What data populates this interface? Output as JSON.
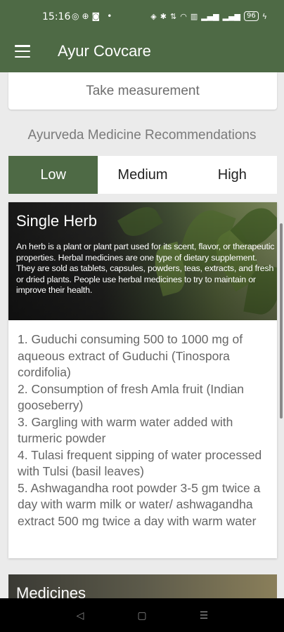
{
  "status_bar": {
    "time": "15:16",
    "left_icons": [
      "whatsapp-icon",
      "hash-icon",
      "instagram-icon",
      "dot-icon"
    ],
    "battery": "96"
  },
  "app_bar": {
    "title": "Ayur Covcare",
    "color": "#4e6a45"
  },
  "measure_button": "Take measurement",
  "section_heading": "Ayurveda Medicine Recommendations",
  "tabs": [
    {
      "label": "Low",
      "active": true
    },
    {
      "label": "Medium",
      "active": false
    },
    {
      "label": "High",
      "active": false
    }
  ],
  "herb_card": {
    "title": "Single Herb",
    "description": "An herb is a plant or plant part used for its scent, flavor, or therapeutic properties. Herbal medicines are one type of dietary supplement. They are sold as tablets, capsules, powders, teas, extracts, and fresh or dried plants. People use herbal medicines to try to maintain or improve their health.",
    "items": [
      "1. Guduchi consuming 500 to 1000 mg of aqueous extract of Guduchi (Tinospora cordifolia)",
      "2. Consumption of fresh Amla fruit (Indian gooseberry)",
      "3. Gargling with warm water added with turmeric powder",
      "4. Tulasi frequent sipping of water processed with Tulsi (basil leaves)",
      "5. Ashwagandha root powder 3-5 gm twice a day with warm milk or water/ ashwagandha extract 500 mg twice a day with warm water"
    ]
  },
  "medicines_card": {
    "title": "Medicines"
  },
  "nav_bar": {
    "back": "◁",
    "home": "▢",
    "recents": "☰"
  }
}
